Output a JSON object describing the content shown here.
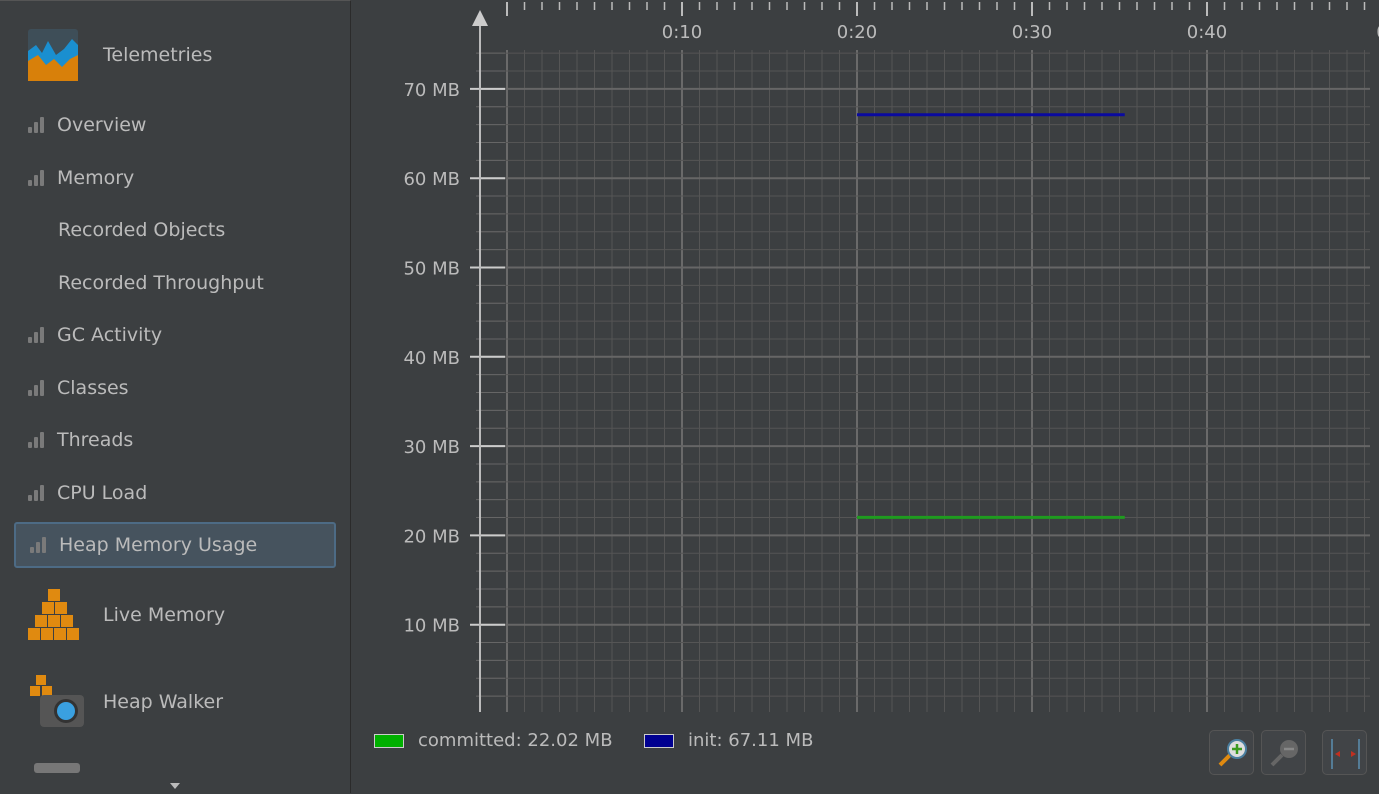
{
  "sidebar": {
    "telemetries": "Telemetries",
    "items": [
      {
        "label": "Overview",
        "icon": "bar-chart-icon"
      },
      {
        "label": "Memory",
        "icon": "bar-chart-icon"
      },
      {
        "label": "Recorded Objects",
        "icon": ""
      },
      {
        "label": "Recorded Throughput",
        "icon": ""
      },
      {
        "label": "GC Activity",
        "icon": "bar-chart-icon"
      },
      {
        "label": "Classes",
        "icon": "bar-chart-icon"
      },
      {
        "label": "Threads",
        "icon": "bar-chart-icon"
      },
      {
        "label": "CPU Load",
        "icon": "bar-chart-icon"
      },
      {
        "label": "Heap Memory Usage",
        "icon": "bar-chart-icon",
        "selected": true
      }
    ],
    "live_memory": "Live Memory",
    "heap_walker": "Heap Walker"
  },
  "chart_data": {
    "type": "line",
    "x_ticks": [
      "0:10",
      "0:20",
      "0:30",
      "0:40",
      "0"
    ],
    "x_tick_values": [
      10,
      20,
      30,
      40,
      50
    ],
    "y_ticks": [
      "10 MB",
      "20 MB",
      "30 MB",
      "40 MB",
      "50 MB",
      "60 MB",
      "70 MB"
    ],
    "y_tick_values": [
      10,
      20,
      30,
      40,
      50,
      60,
      70
    ],
    "xlim": [
      0,
      49.5
    ],
    "ylim": [
      0,
      70
    ],
    "series": [
      {
        "name": "committed",
        "color": "#1f9b1f",
        "x": [
          20,
          35.3
        ],
        "y": [
          22.02,
          22.02
        ]
      },
      {
        "name": "init",
        "color": "#0a0aa0",
        "x": [
          20,
          35.3
        ],
        "y": [
          67.11,
          67.11
        ]
      }
    ],
    "legend": [
      {
        "label": "committed:",
        "value": "22.02 MB",
        "color": "#00b000"
      },
      {
        "label": "init:",
        "value": "67.11 MB",
        "color": "#000090"
      }
    ]
  }
}
